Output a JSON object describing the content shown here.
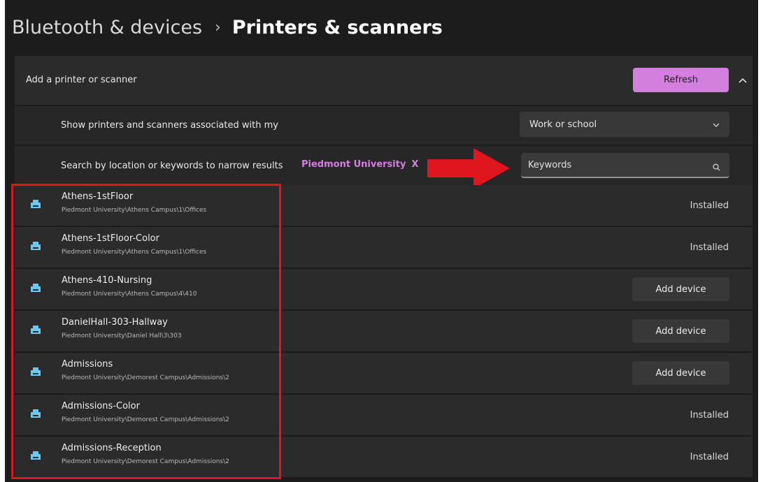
{
  "breadcrumb": {
    "parent": "Bluetooth & devices",
    "separator": "›",
    "current": "Printers & scanners"
  },
  "add_section": {
    "label": "Add a printer or scanner",
    "refresh_label": "Refresh",
    "collapse_icon": "chevron-up-icon"
  },
  "association": {
    "label": "Show printers and scanners associated with my",
    "selected": "Work or school"
  },
  "search": {
    "label": "Search by location or keywords to narrow results",
    "filter_chip": "Piedmont University",
    "filter_remove": "X",
    "placeholder": "Keywords"
  },
  "printers": [
    {
      "name": "Athens-1stFloor",
      "path": "Piedmont University\\Athens Campus\\1\\Offices",
      "status": "Installed",
      "action": ""
    },
    {
      "name": "Athens-1stFloor-Color",
      "path": "Piedmont University\\Athens Campus\\1\\Offices",
      "status": "Installed",
      "action": ""
    },
    {
      "name": "Athens-410-Nursing",
      "path": "Piedmont University\\Athens Campus\\4\\410",
      "status": "",
      "action": "Add device"
    },
    {
      "name": "DanielHall-303-Hallway",
      "path": "Piedmont University\\Daniel Hall\\3\\303",
      "status": "",
      "action": "Add device"
    },
    {
      "name": "Admissions",
      "path": "Piedmont University\\Demorest Campus\\Admissions\\2",
      "status": "",
      "action": "Add device"
    },
    {
      "name": "Admissions-Color",
      "path": "Piedmont University\\Demorest Campus\\Admissions\\2",
      "status": "Installed",
      "action": ""
    },
    {
      "name": "Admissions-Reception",
      "path": "Piedmont University\\Demorest Campus\\Admissions\\2",
      "status": "Installed",
      "action": ""
    }
  ],
  "colors": {
    "accent": "#d27fde",
    "annotation_red": "#e0161e",
    "printer_icon": "#6fc8f0"
  }
}
